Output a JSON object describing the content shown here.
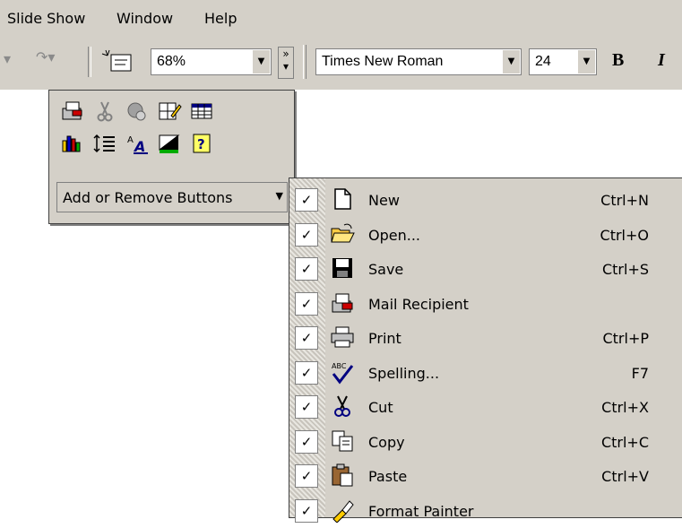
{
  "menubar": {
    "items": [
      {
        "label": "Slide Show"
      },
      {
        "label": "Window"
      },
      {
        "label": "Help"
      }
    ]
  },
  "toolbar": {
    "zoom": "68%",
    "font": "Times New Roman",
    "font_size": "24",
    "bold_label": "B",
    "italic_label": "I"
  },
  "panel": {
    "add_remove_label": "Add or Remove Buttons"
  },
  "dropdown": {
    "items": [
      {
        "label": "New",
        "shortcut": "Ctrl+N",
        "icon": "new-document-icon"
      },
      {
        "label": "Open...",
        "shortcut": "Ctrl+O",
        "icon": "open-folder-icon"
      },
      {
        "label": "Save",
        "shortcut": "Ctrl+S",
        "icon": "save-disk-icon"
      },
      {
        "label": "Mail Recipient",
        "shortcut": "",
        "icon": "mail-recipient-icon"
      },
      {
        "label": "Print",
        "shortcut": "Ctrl+P",
        "icon": "printer-icon"
      },
      {
        "label": "Spelling...",
        "shortcut": "F7",
        "icon": "spelling-icon"
      },
      {
        "label": "Cut",
        "shortcut": "Ctrl+X",
        "icon": "scissors-icon"
      },
      {
        "label": "Copy",
        "shortcut": "Ctrl+C",
        "icon": "copy-icon"
      },
      {
        "label": "Paste",
        "shortcut": "Ctrl+V",
        "icon": "paste-icon"
      },
      {
        "label": "Format Painter",
        "shortcut": "",
        "icon": "format-painter-icon"
      }
    ]
  },
  "colors": {
    "face": "#d4d0c8",
    "shadow": "#808080",
    "highlight": "#ffffff"
  }
}
